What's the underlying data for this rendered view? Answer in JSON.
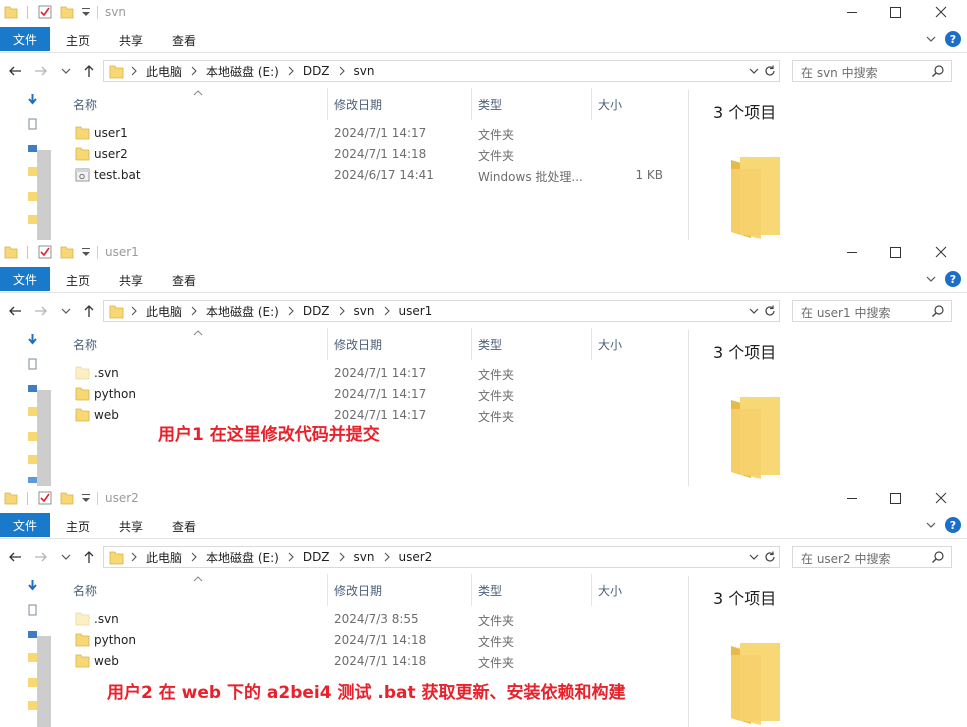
{
  "ribbon": {
    "file": "文件",
    "home": "主页",
    "share": "共享",
    "view": "查看"
  },
  "columns": {
    "name": "名称",
    "date": "修改日期",
    "type": "类型",
    "size": "大小"
  },
  "windows": [
    {
      "title": "svn",
      "breadcrumb": [
        "此电脑",
        "本地磁盘 (E:)",
        "DDZ",
        "svn"
      ],
      "search_placeholder": "在 svn 中搜索",
      "item_count": "3 个项目",
      "files": [
        {
          "name": "user1",
          "date": "2024/7/1 14:17",
          "type": "文件夹",
          "size": "",
          "icon": "folder-icon"
        },
        {
          "name": "user2",
          "date": "2024/7/1 14:18",
          "type": "文件夹",
          "size": "",
          "icon": "folder-icon"
        },
        {
          "name": "test.bat",
          "date": "2024/6/17 14:41",
          "type": "Windows 批处理...",
          "size": "1 KB",
          "icon": "batch-file-icon"
        }
      ]
    },
    {
      "title": "user1",
      "breadcrumb": [
        "此电脑",
        "本地磁盘 (E:)",
        "DDZ",
        "svn",
        "user1"
      ],
      "search_placeholder": "在 user1 中搜索",
      "item_count": "3 个项目",
      "files": [
        {
          "name": ".svn",
          "date": "2024/7/1 14:17",
          "type": "文件夹",
          "size": "",
          "icon": "hidden-folder-icon"
        },
        {
          "name": "python",
          "date": "2024/7/1 14:17",
          "type": "文件夹",
          "size": "",
          "icon": "folder-icon"
        },
        {
          "name": "web",
          "date": "2024/7/1 14:17",
          "type": "文件夹",
          "size": "",
          "icon": "folder-icon"
        }
      ]
    },
    {
      "title": "user2",
      "breadcrumb": [
        "此电脑",
        "本地磁盘 (E:)",
        "DDZ",
        "svn",
        "user2"
      ],
      "search_placeholder": "在 user2 中搜索",
      "item_count": "3 个项目",
      "files": [
        {
          "name": ".svn",
          "date": "2024/7/3 8:55",
          "type": "文件夹",
          "size": "",
          "icon": "hidden-folder-icon"
        },
        {
          "name": "python",
          "date": "2024/7/1 14:18",
          "type": "文件夹",
          "size": "",
          "icon": "folder-icon"
        },
        {
          "name": "web",
          "date": "2024/7/1 14:18",
          "type": "文件夹",
          "size": "",
          "icon": "folder-icon"
        }
      ]
    }
  ],
  "annotations": {
    "user1": "用户1 在这里修改代码并提交",
    "user2": "用户2 在 web 下的 a2bei4 测试 .bat 获取更新、安装依赖和构建"
  },
  "colors": {
    "folder": "#f8d775",
    "file_tab": "#1979ca",
    "annotation": "#e8212b",
    "help": "#1c6fc6"
  }
}
